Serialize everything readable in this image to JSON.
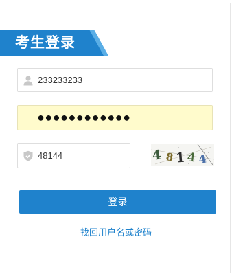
{
  "title": "考生登录",
  "username": {
    "value": "233233233",
    "icon": "user-icon"
  },
  "password": {
    "masked_value": "●●●●●●●●●●●●"
  },
  "captcha": {
    "input_value": "48144",
    "icon": "shield-icon",
    "image_text": "48144"
  },
  "login_button_label": "登录",
  "recover_link_label": "找回用户名或密码",
  "colors": {
    "accent": "#1f82cc",
    "ribbon_light": "#5aaee6",
    "autofill_bg": "#fffbcc"
  }
}
